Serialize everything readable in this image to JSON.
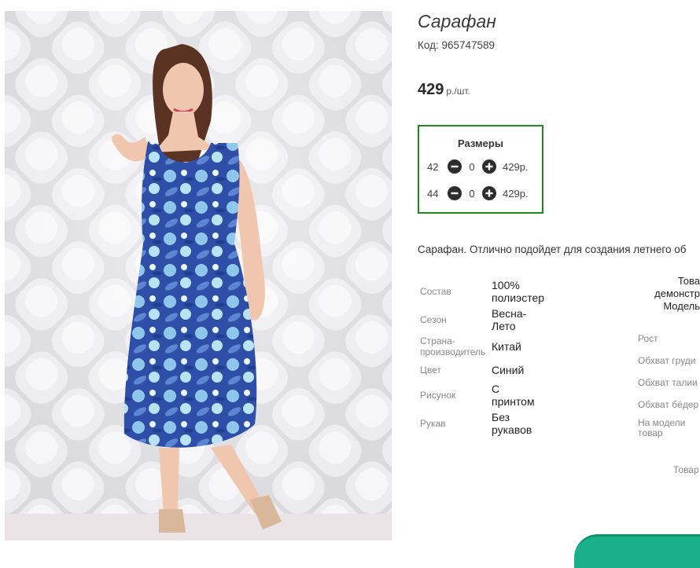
{
  "product": {
    "title": "Сарафан",
    "code": "Код: 965747589",
    "price": "429",
    "price_unit": "р./шт."
  },
  "sizes": {
    "title": "Размеры",
    "rows": [
      {
        "size": "42",
        "qty": "0",
        "price": "429р."
      },
      {
        "size": "44",
        "qty": "0",
        "price": "429р."
      }
    ]
  },
  "description": "Сарафан. Отлично подойдет для создания летнего об",
  "specs": [
    {
      "label": "Состав",
      "value": [
        "100%",
        "полиэстер"
      ]
    },
    {
      "label": "Сезон",
      "value": [
        "Весна-",
        "Лето"
      ]
    },
    {
      "label": [
        "Страна-",
        "производитель"
      ],
      "value": [
        "Китай"
      ]
    },
    {
      "label": "Цвет",
      "value": [
        "Синий"
      ]
    },
    {
      "label": "Рисунок",
      "value": [
        "С",
        "принтом"
      ]
    },
    {
      "label": "Рукав",
      "value": [
        "Без",
        "рукавов"
      ]
    }
  ],
  "model_note": [
    "Това",
    "демонстр",
    "Модель"
  ],
  "measurements": [
    "Рост",
    "Обхват груди",
    "Обхват талии",
    "Обхват бёдер",
    [
      "На модели",
      "товар"
    ]
  ],
  "bottom_note": "Товар",
  "colors": {
    "accent_green": "#1e8a1e",
    "tab_teal": "#19b08a"
  }
}
